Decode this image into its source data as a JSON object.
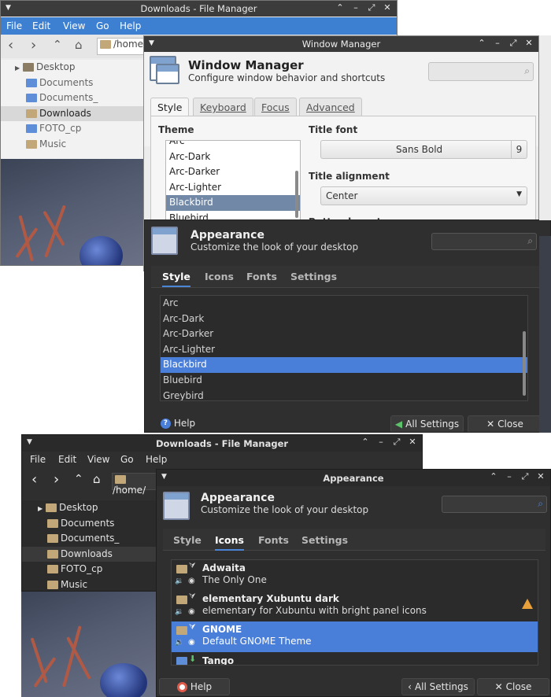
{
  "fm1": {
    "title": "Downloads - File Manager",
    "menu": [
      "File",
      "Edit",
      "View",
      "Go",
      "Help"
    ],
    "path": "/home/",
    "sidebar": [
      "Desktop",
      "Documents",
      "Documents_",
      "Downloads",
      "FOTO_cp",
      "Music"
    ],
    "selected": "Downloads"
  },
  "wm": {
    "title": "Window Manager",
    "heading": "Window Manager",
    "subtitle": "Configure window behavior and shortcuts",
    "tabs": [
      "Style",
      "Keyboard",
      "Focus",
      "Advanced"
    ],
    "theme_label": "Theme",
    "themes": [
      "Arc",
      "Arc-Dark",
      "Arc-Darker",
      "Arc-Lighter",
      "Blackbird",
      "Bluebird"
    ],
    "selected_theme": "Blackbird",
    "title_font_label": "Title font",
    "title_font": "Sans Bold",
    "title_font_size": "9",
    "title_alignment_label": "Title alignment",
    "title_alignment": "Center",
    "button_layout_label": "Button layout"
  },
  "appearance1": {
    "heading": "Appearance",
    "subtitle": "Customize the look of your desktop",
    "tabs": [
      "Style",
      "Icons",
      "Fonts",
      "Settings"
    ],
    "styles": [
      "Arc",
      "Arc-Dark",
      "Arc-Darker",
      "Arc-Lighter",
      "Blackbird",
      "Bluebird",
      "Greybird"
    ],
    "selected_style": "Blackbird",
    "help": "Help",
    "all_settings": "All Settings",
    "close": "Close"
  },
  "fm2": {
    "title": "Downloads - File Manager",
    "menu": [
      "File",
      "Edit",
      "View",
      "Go",
      "Help"
    ],
    "path": "/home/",
    "sidebar": [
      "Desktop",
      "Documents",
      "Documents_",
      "Downloads",
      "FOTO_cp",
      "Music"
    ]
  },
  "appearance2": {
    "title": "Appearance",
    "heading": "Appearance",
    "subtitle": "Customize the look of your desktop",
    "tabs": [
      "Style",
      "Icons",
      "Fonts",
      "Settings"
    ],
    "icon_themes": [
      {
        "name": "Adwaita",
        "desc": "The Only One"
      },
      {
        "name": "elementary Xubuntu dark",
        "desc": "elementary for Xubuntu with bright panel icons"
      },
      {
        "name": "GNOME",
        "desc": "Default GNOME Theme"
      },
      {
        "name": "Tango",
        "desc": ""
      }
    ],
    "help": "Help",
    "all_settings": "All Settings",
    "close": "Close"
  },
  "colors": {
    "selection_blue": "#4a7fd9",
    "menubar_blue": "#3d7fd1",
    "warning": "#e8a03a"
  }
}
